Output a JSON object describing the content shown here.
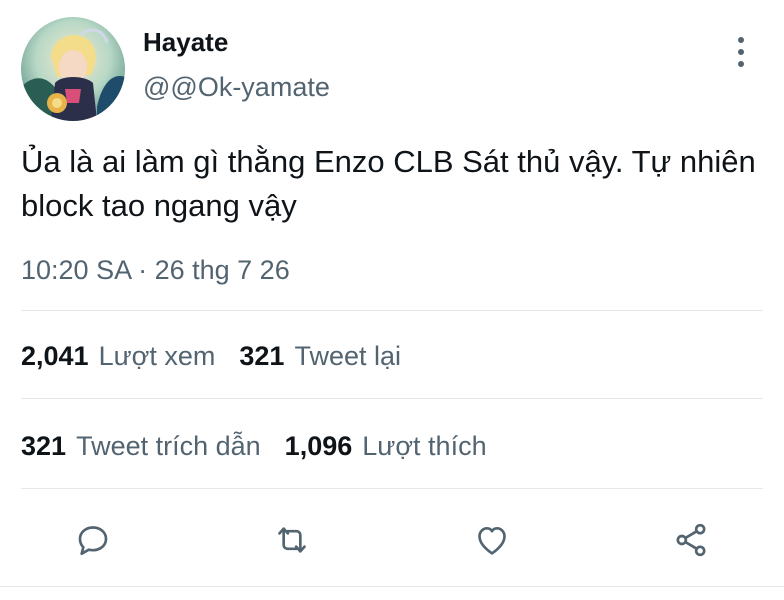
{
  "user": {
    "display_name": "Hayate",
    "handle": "@@Ok-yamate"
  },
  "tweet": {
    "text": "Ủa là ai làm gì thằng Enzo CLB Sát thủ vậy. Tự nhiên block tao ngang vậy",
    "timestamp": "10:20 SA · 26 thg 7 26"
  },
  "stats": {
    "views": {
      "value": "2,041",
      "label": "Lượt xem"
    },
    "retweets": {
      "value": "321",
      "label": "Tweet lại"
    },
    "quotes": {
      "value": "321",
      "label": "Tweet trích dẫn"
    },
    "likes": {
      "value": "1,096",
      "label": "Lượt thích"
    }
  },
  "icons": {
    "reply": "reply-icon",
    "retweet": "retweet-icon",
    "like": "heart-icon",
    "share": "share-icon",
    "more": "more-icon"
  },
  "colors": {
    "text": "#0f1419",
    "secondary": "#536471",
    "divider": "#e4e9ec"
  }
}
